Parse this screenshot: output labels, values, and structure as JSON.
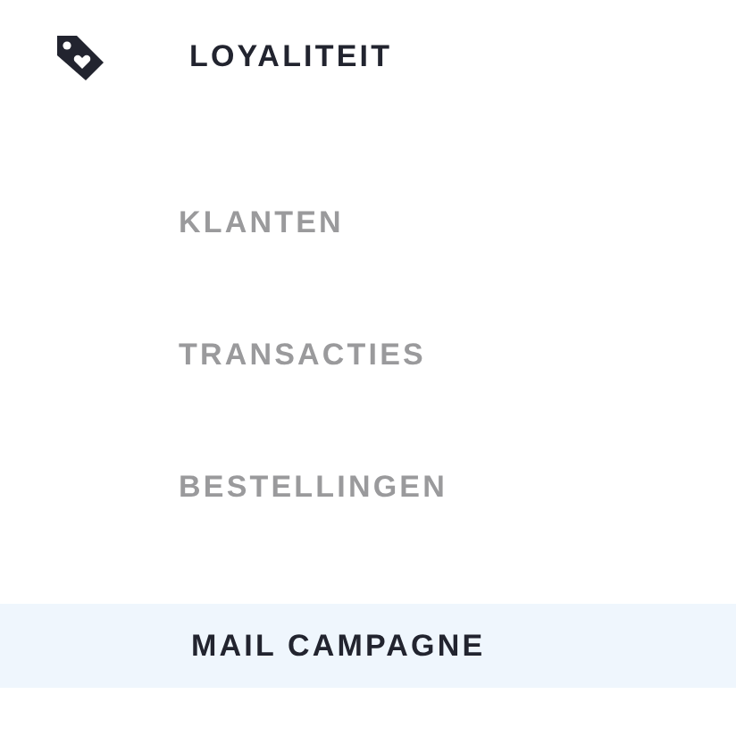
{
  "sidebar": {
    "header": {
      "label": "LOYALITEIT"
    },
    "items": [
      {
        "label": "KLANTEN",
        "selected": false
      },
      {
        "label": "TRANSACTIES",
        "selected": false
      },
      {
        "label": "BESTELLINGEN",
        "selected": false
      },
      {
        "label": "MAIL CAMPAGNE",
        "selected": true
      }
    ]
  }
}
